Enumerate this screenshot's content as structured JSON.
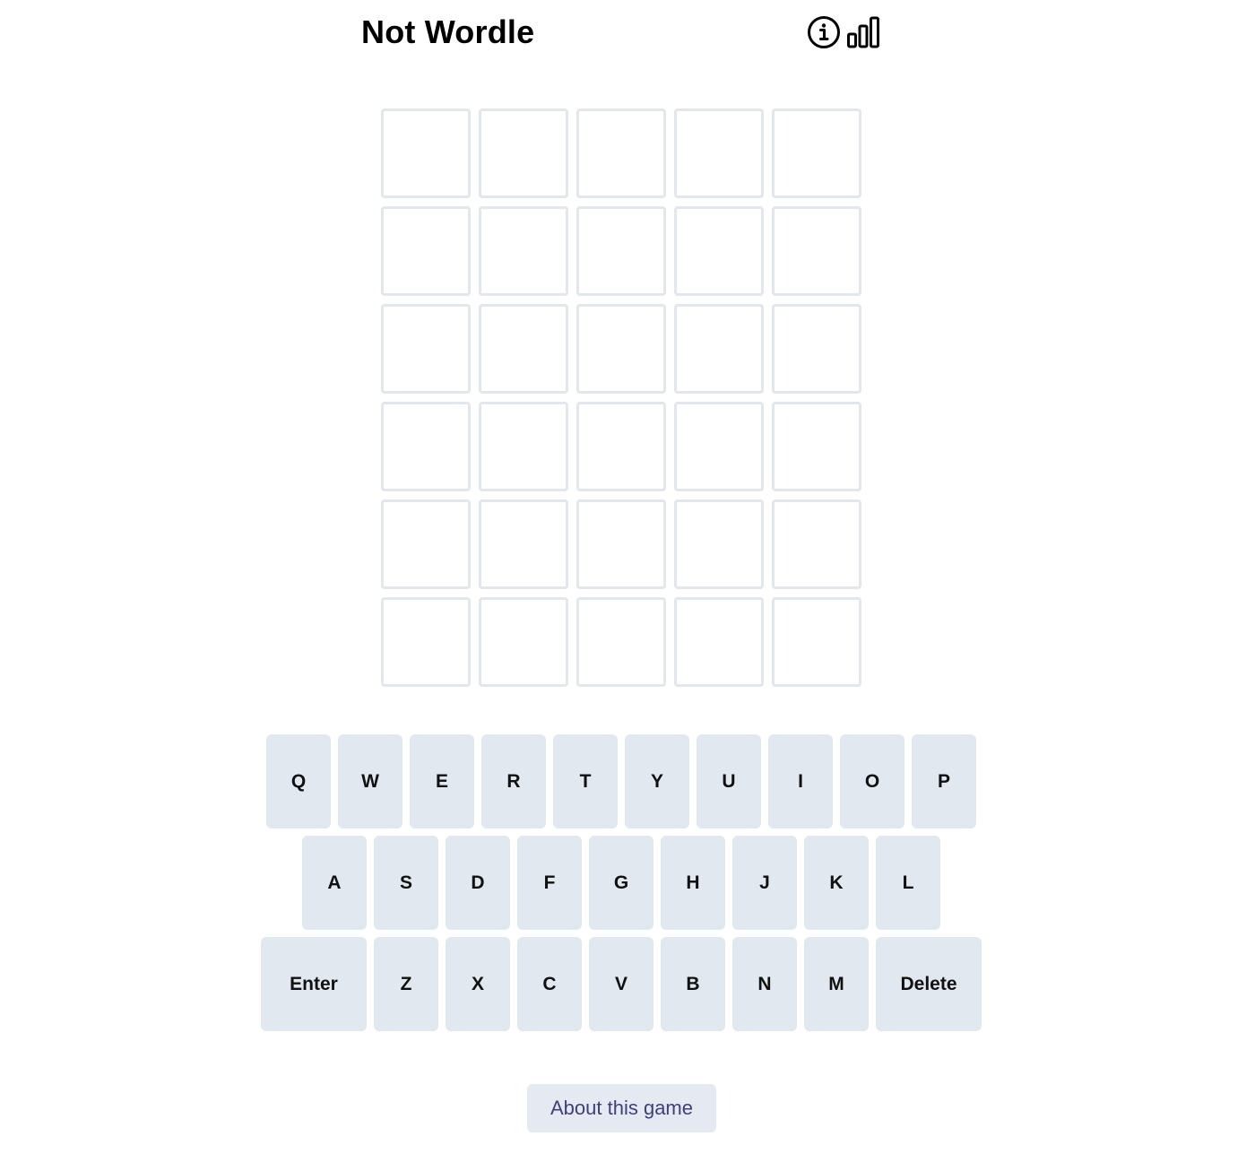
{
  "header": {
    "title": "Not Wordle",
    "icons": [
      {
        "name": "info-icon"
      },
      {
        "name": "stats-chart-icon"
      }
    ]
  },
  "board": {
    "rows": [
      [
        "",
        "",
        "",
        "",
        ""
      ],
      [
        "",
        "",
        "",
        "",
        ""
      ],
      [
        "",
        "",
        "",
        "",
        ""
      ],
      [
        "",
        "",
        "",
        "",
        ""
      ],
      [
        "",
        "",
        "",
        "",
        ""
      ],
      [
        "",
        "",
        "",
        "",
        ""
      ]
    ],
    "border_color": "#e2e6ed"
  },
  "keyboard": {
    "row1": [
      "Q",
      "W",
      "E",
      "R",
      "T",
      "Y",
      "U",
      "I",
      "O",
      "P"
    ],
    "row2": [
      "A",
      "S",
      "D",
      "F",
      "G",
      "H",
      "J",
      "K",
      "L"
    ],
    "row3": [
      "Enter",
      "Z",
      "X",
      "C",
      "V",
      "B",
      "N",
      "M",
      "Delete"
    ],
    "key_color": "#e2e8f0"
  },
  "footer": {
    "about_label": "About this game",
    "about_text_color": "#3f3f7a"
  }
}
